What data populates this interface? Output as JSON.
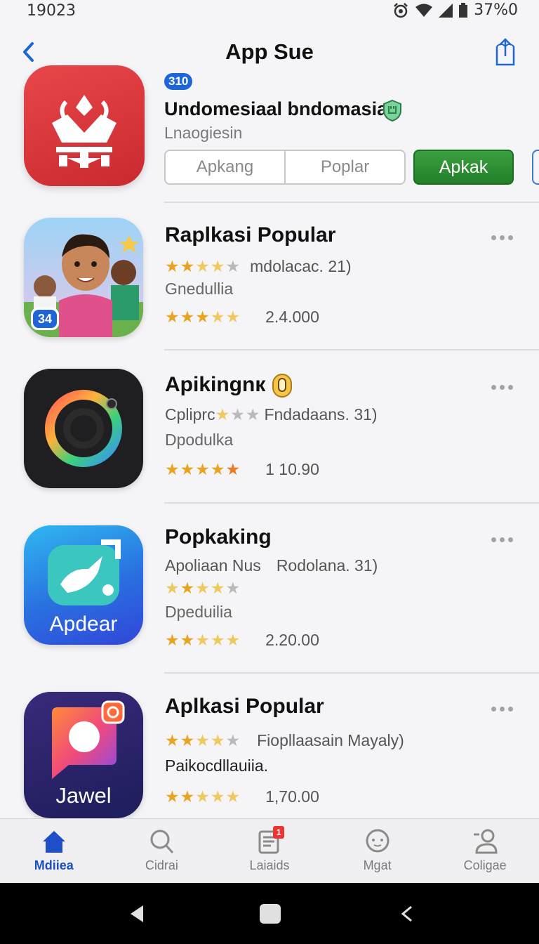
{
  "status": {
    "time": "19023",
    "battery": "37%0"
  },
  "nav": {
    "title": "App Sue"
  },
  "hero": {
    "badge": "310",
    "title": "Undomesiaal bndomasia",
    "subtitle": "Lnaogiesin",
    "segments": [
      "Apkang",
      "Poplar"
    ],
    "action": "Apkak"
  },
  "apps": [
    {
      "title": "Raplkasi Popular",
      "line1_text": "mdolacac. 21)",
      "line1_stars": [
        1,
        1,
        0.5,
        0.3,
        0
      ],
      "subtitle": "Gnedullia",
      "rating_stars": [
        1,
        1,
        1,
        0.6,
        0.4
      ],
      "rating_value": "2.4.000",
      "icon_badge": "34",
      "icon_name": "kids-photo-icon"
    },
    {
      "title": "Apikingnк",
      "line1_pre": "Cpliprc",
      "line1_text": "Fndadaans. 31)",
      "line1_stars": [
        0.4,
        0,
        0
      ],
      "subtitle": "Dpodulka",
      "rating_stars": [
        1,
        1,
        1,
        1,
        1
      ],
      "rating_value": "1 10.90",
      "icon_name": "camera-ring-icon"
    },
    {
      "title": "Popkaking",
      "line1_pre": "Apoliaan Nus",
      "line1_text": "Rodolana. 31)",
      "line1_stars": [
        0.6,
        1,
        0.5,
        0.4,
        0
      ],
      "subtitle": "Dpeduilia",
      "rating_stars": [
        1,
        1,
        0.5,
        0.6,
        0.6
      ],
      "rating_value": "2.20.00",
      "icon_label": "Apdear",
      "icon_name": "bird-chat-icon"
    },
    {
      "title": "Aplkasi Popular",
      "line1_text": "Fiopllaasain Mayaly)",
      "line1_stars": [
        1,
        1,
        0.5,
        0.3,
        0
      ],
      "subtitle": "Paikocdllauiia.",
      "rating_stars": [
        1,
        1,
        0.5,
        0.6,
        0.6
      ],
      "rating_value": "1,70.00",
      "icon_label": "Jawel",
      "icon_name": "camera-bubble-icon"
    }
  ],
  "tabs": [
    {
      "label": "Mdiiea",
      "icon": "home-icon",
      "active": true
    },
    {
      "label": "Cidrai",
      "icon": "search-icon",
      "active": false
    },
    {
      "label": "Laiaids",
      "icon": "clipboard-icon",
      "active": false,
      "badge": "1"
    },
    {
      "label": "Mgat",
      "icon": "chat-icon",
      "active": false
    },
    {
      "label": "Coligae",
      "icon": "person-icon",
      "active": false
    }
  ],
  "colors": {
    "accent": "#1e66d8",
    "green": "#2a8f30",
    "star": "#e8a420"
  }
}
